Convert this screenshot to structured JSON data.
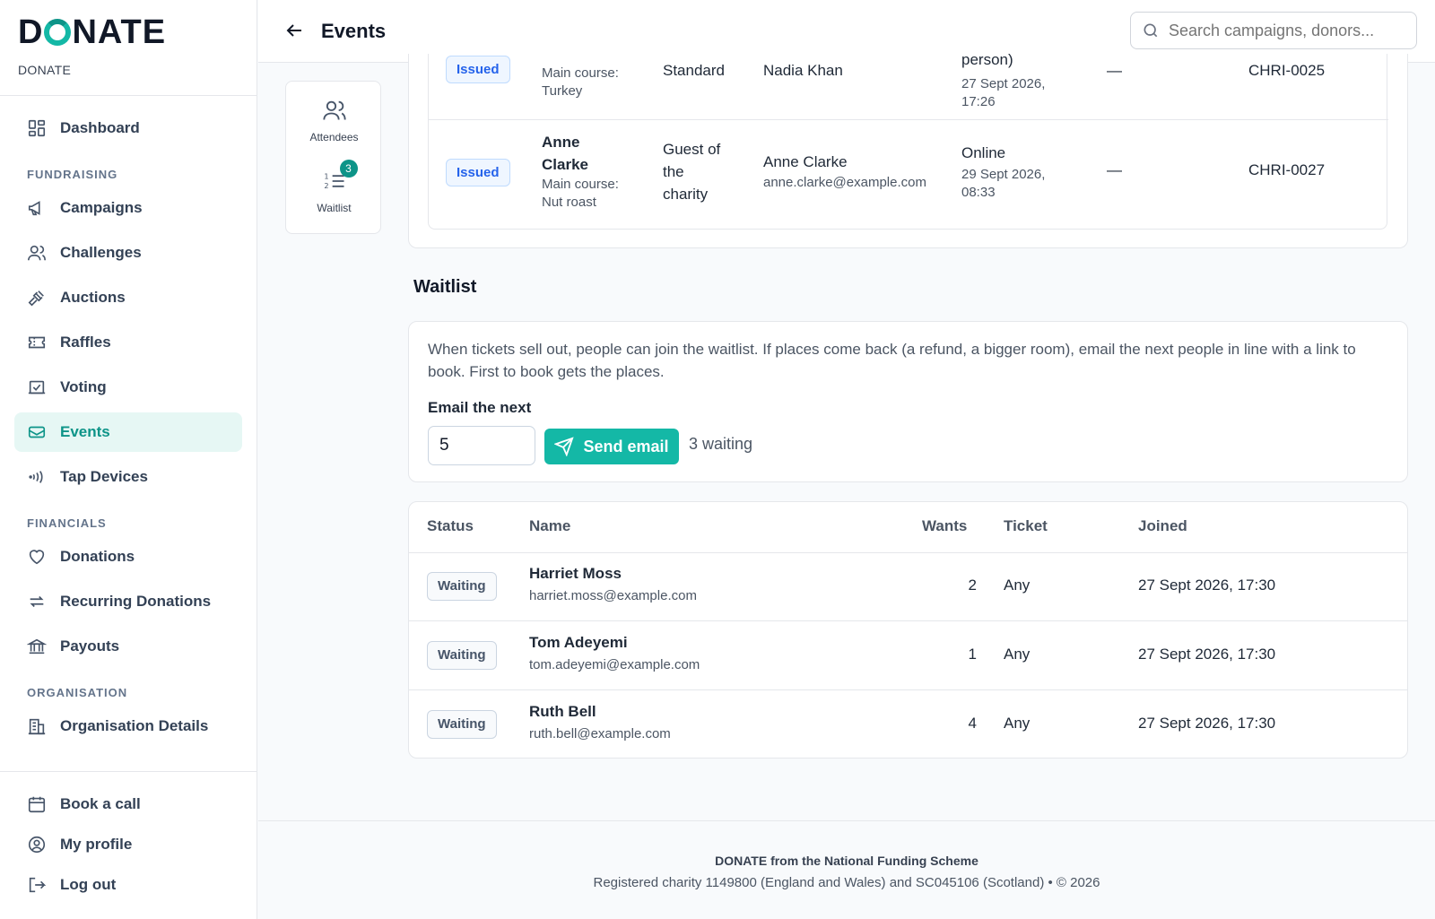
{
  "brand": {
    "logo_text_a": "D",
    "logo_text_b": "NATE",
    "org_name": "DONATE"
  },
  "header": {
    "title": "Events",
    "search_placeholder": "Search campaigns, donors..."
  },
  "sidebar": {
    "dashboard": "Dashboard",
    "section_fundraising": "FUNDRAISING",
    "campaigns": "Campaigns",
    "challenges": "Challenges",
    "auctions": "Auctions",
    "raffles": "Raffles",
    "voting": "Voting",
    "events": "Events",
    "tap_devices": "Tap Devices",
    "section_financials": "FINANCIALS",
    "donations": "Donations",
    "recurring_donations": "Recurring Donations",
    "payouts": "Payouts",
    "section_organisation": "ORGANISATION",
    "organisation_details": "Organisation Details",
    "book_call": "Book a call",
    "my_profile": "My profile",
    "log_out": "Log out"
  },
  "tabs": {
    "attendees": "Attendees",
    "waitlist": "Waitlist",
    "waitlist_badge": "3"
  },
  "attendees_rows": [
    {
      "status": "Issued",
      "name": "",
      "course": "Main course:\nTurkey",
      "ticket": "Standard",
      "buyer_name": "Nadia Khan",
      "buyer_email": "",
      "channel": "person)",
      "date": "27 Sept 2026,\n17:26",
      "dash": "—",
      "ref": "CHRI-0025"
    },
    {
      "status": "Issued",
      "name": "Anne\nClarke",
      "course": "Main course:\nNut roast",
      "ticket": "Guest of\nthe\ncharity",
      "buyer_name": "Anne Clarke",
      "buyer_email": "anne.clarke@example.com",
      "channel": "Online",
      "date": "29 Sept 2026,\n08:33",
      "dash": "—",
      "ref": "CHRI-0027"
    }
  ],
  "waitlist": {
    "title": "Waitlist",
    "info": "When tickets sell out, people can join the waitlist. If places come back (a refund, a bigger room), email the next people in line with a link to book. First to book gets the places.",
    "email_label": "Email the next",
    "email_count": "5",
    "send_label": "Send email",
    "waiting_text": "3 waiting",
    "columns": {
      "status": "Status",
      "name": "Name",
      "wants": "Wants",
      "ticket": "Ticket",
      "joined": "Joined"
    },
    "rows": [
      {
        "status": "Waiting",
        "name": "Harriet Moss",
        "email": "harriet.moss@example.com",
        "wants": "2",
        "ticket": "Any",
        "joined": "27 Sept 2026, 17:30"
      },
      {
        "status": "Waiting",
        "name": "Tom Adeyemi",
        "email": "tom.adeyemi@example.com",
        "wants": "1",
        "ticket": "Any",
        "joined": "27 Sept 2026, 17:30"
      },
      {
        "status": "Waiting",
        "name": "Ruth Bell",
        "email": "ruth.bell@example.com",
        "wants": "4",
        "ticket": "Any",
        "joined": "27 Sept 2026, 17:30"
      }
    ]
  },
  "footer": {
    "line1": "DONATE from the National Funding Scheme",
    "line2": "Registered charity 1149800 (England and Wales) and SC045106 (Scotland)  •  © 2026"
  },
  "colors": {
    "accent": "#14b8a6",
    "accent_dark": "#0d9488",
    "active_bg": "#e6f7f4",
    "issued_blue": "#2563eb"
  }
}
